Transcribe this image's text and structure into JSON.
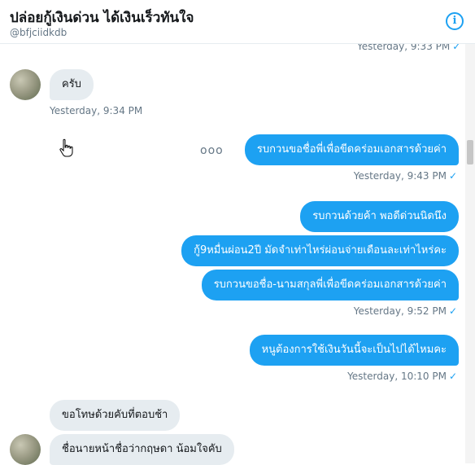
{
  "header": {
    "title": "ปล่อยกู้เงินด่วน ได้เงินเร็วทันใจ",
    "handle": "@bfjciidkdb",
    "info_icon": "i"
  },
  "messages": [
    {
      "text": "",
      "time": "Yesterday, 9:33 PM",
      "direction": "out"
    },
    {
      "text": "ครับ",
      "time": "Yesterday, 9:34 PM",
      "direction": "in"
    },
    {
      "text": "รบกวนขอชื่อพี่เพื่อขีดคร่อมเอกสารด้วยค่า",
      "time": "Yesterday, 9:43 PM",
      "direction": "out"
    },
    {
      "text": "รบกวนด้วยค้า พอดีด่วนนิดนึง",
      "time": "",
      "direction": "out"
    },
    {
      "text": "กู้9หมื่นผ่อน2ปี มัดจำเท่าไหร่ผ่อนจ่ายเดือนละเท่าไหร่คะ",
      "time": "",
      "direction": "out"
    },
    {
      "text": "รบกวนขอชื่อ-นามสกุลพี่เพื่อขีดคร่อมเอกสารด้วยค่า",
      "time": "Yesterday, 9:52 PM",
      "direction": "out"
    },
    {
      "text": "หนูต้องการใช้เงินวันนี้จะเป็นไปได้ไหมคะ",
      "time": "Yesterday, 10:10 PM",
      "direction": "out"
    },
    {
      "text": "ขอโทษด้วยคับที่ตอบช้า",
      "time": "",
      "direction": "in"
    },
    {
      "text": "ชื่อนายหน้าชื่อว่ากฤษดา น้อมใจคับ",
      "time": "",
      "direction": "in"
    }
  ],
  "more_icon": "ooo",
  "checkmark": "✓",
  "colors": {
    "accent": "#1da1f2",
    "incoming_bubble": "#e6ecf0",
    "timestamp": "#657786"
  }
}
